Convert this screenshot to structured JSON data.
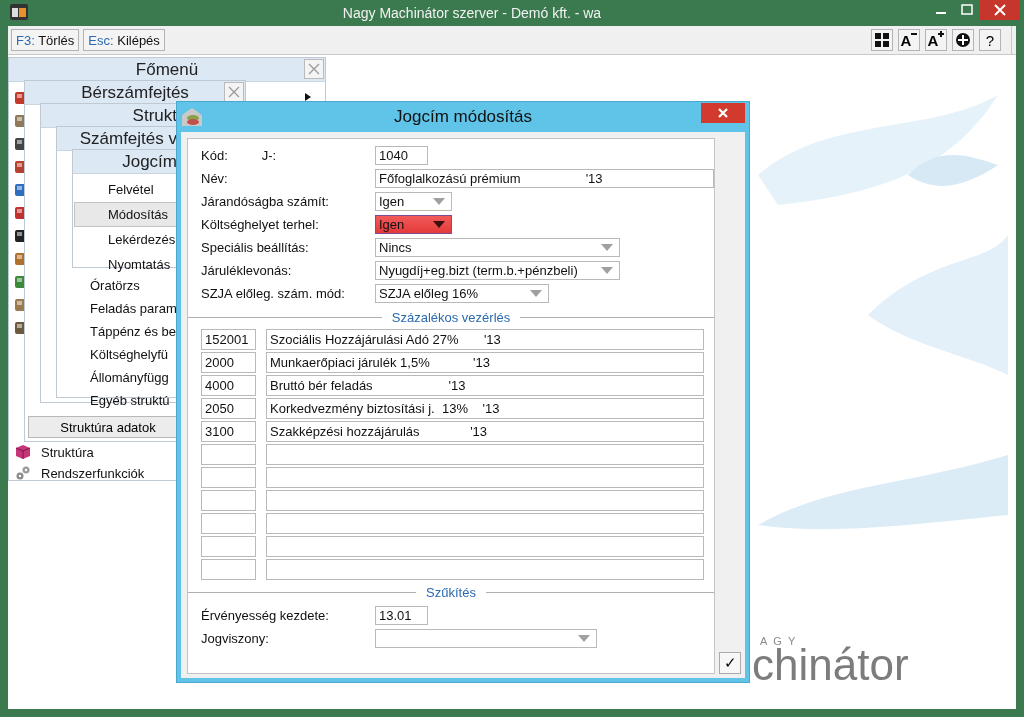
{
  "window": {
    "title": "Nagy Machinátor szerver - Demó kft. - wa"
  },
  "toolbar": {
    "buttons": [
      {
        "key": "F3:",
        "label": "Törlés"
      },
      {
        "key": "Esc:",
        "label": "Kilépés"
      }
    ],
    "icon_buttons": [
      {
        "kind": "grid"
      },
      {
        "kind": "smaller",
        "text": "A"
      },
      {
        "kind": "larger",
        "text": "A"
      },
      {
        "kind": "circle"
      },
      {
        "kind": "help",
        "text": "?"
      }
    ]
  },
  "menus": [
    {
      "title": "Főmenü",
      "items": [
        {
          "label": "Struktúra"
        },
        {
          "label": "Rendszerfunkciók"
        }
      ]
    },
    {
      "title": "Bérszámfejtés",
      "footer_button": "Struktúra adatok"
    },
    {
      "title": "Strukt"
    },
    {
      "title": "Számfejtés v",
      "items": [
        {
          "label": "Óratörzs"
        },
        {
          "label": "Feladás param"
        },
        {
          "label": "Táppénz és be"
        },
        {
          "label": "Költséghelyfü"
        },
        {
          "label": "Állományfügg"
        },
        {
          "label": "Egyéb struktú"
        }
      ]
    },
    {
      "title": "Jogcím",
      "items": [
        {
          "label": "Felvétel",
          "selected": false
        },
        {
          "label": "Módosítás",
          "selected": true
        },
        {
          "label": "Lekérdezés",
          "selected": false
        },
        {
          "label": "Nyomtatás",
          "selected": false
        }
      ]
    }
  ],
  "dialog": {
    "title": "Jogcím módosítás",
    "fields": [
      {
        "label": "Kód:",
        "prefix": "J-:",
        "kind": "text",
        "value": "1040",
        "highlighted": false
      },
      {
        "label": "Név:",
        "kind": "text",
        "value": "Főfoglalkozású prémium                  '13",
        "highlighted": false
      },
      {
        "label": "Járandóságba számít:",
        "kind": "dropdown",
        "value": "Igen",
        "highlighted": false
      },
      {
        "label": "Költséghelyet terhel:",
        "kind": "dropdown",
        "value": "Igen",
        "highlighted": true
      },
      {
        "label": "Speciális beállítás:",
        "kind": "dropdown",
        "value": "Nincs",
        "highlighted": false
      },
      {
        "label": "Járuléklevonás:",
        "kind": "dropdown",
        "value": "Nyugdíj+eg.bizt (term.b.+pénzbeli)",
        "highlighted": false
      },
      {
        "label": "SZJA előleg. szám. mód:",
        "kind": "dropdown",
        "value": "SZJA előleg 16%",
        "highlighted": false
      }
    ],
    "percent_section": {
      "title": "Százalékos vezérlés",
      "rows": [
        {
          "code": "152001",
          "name": "Szociális Hozzájárulási Adó 27%       '13"
        },
        {
          "code": "2000",
          "name": "Munkaerőpiaci járulék 1,5%            '13"
        },
        {
          "code": "4000",
          "name": "Bruttó bér feladás                     '13"
        },
        {
          "code": "2050",
          "name": "Korkedvezmény biztosítási j.  13%    '13"
        },
        {
          "code": "3100",
          "name": "Szakképzési hozzájárulás              '13"
        }
      ]
    },
    "filter_section": {
      "title": "Szűkítés",
      "fields": [
        {
          "label": "Érvényesség kezdete:",
          "kind": "text",
          "value": "13.01",
          "highlighted": false
        },
        {
          "label": "Jogviszony:",
          "kind": "dropdown",
          "highlighted": false
        }
      ]
    },
    "confirm_button": "✓"
  },
  "logo": {
    "small": "AGY",
    "large": "chinátor"
  }
}
